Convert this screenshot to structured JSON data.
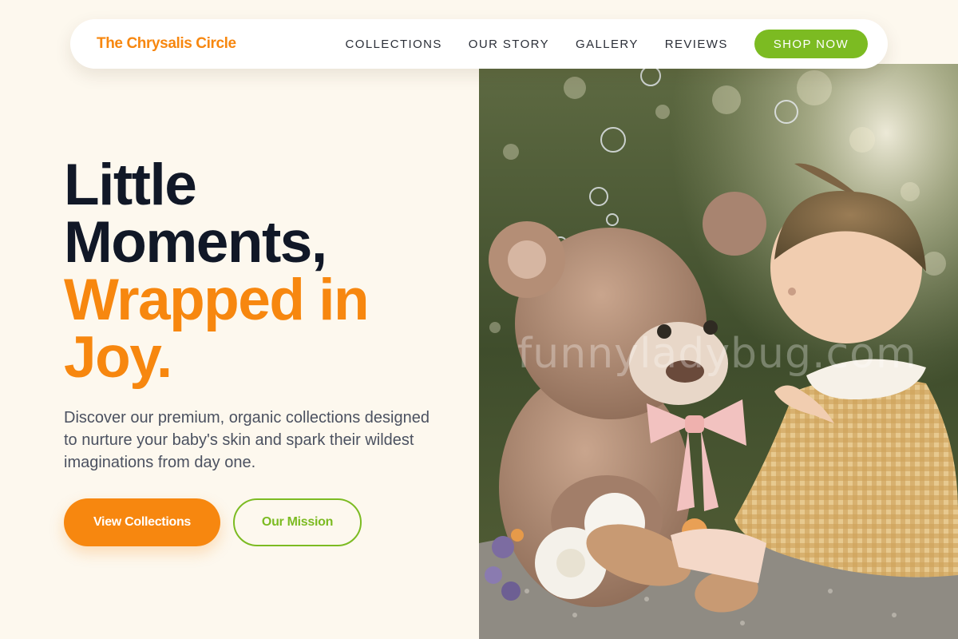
{
  "nav": {
    "brand": "The Chrysalis Circle",
    "links": [
      "COLLECTIONS",
      "OUR STORY",
      "GALLERY",
      "REVIEWS"
    ],
    "cta": "SHOP NOW"
  },
  "hero": {
    "title_dark": [
      "Little",
      "Moments,"
    ],
    "title_accent": [
      "Wrapped in",
      "Joy."
    ],
    "description": "Discover our premium, organic collections designed to nurture your baby's skin and spark their wildest imaginations from day one.",
    "primary_button": "View Collections",
    "secondary_button": "Our Mission",
    "image_alt": "Baby in a gingham dress sitting beside a large teddy bear with bubbles in a sunny park",
    "watermark": "funnyladybug.com"
  },
  "colors": {
    "accent_orange": "#f7870f",
    "accent_green": "#7cbb22",
    "heading": "#111827",
    "background": "#fdf8ee"
  },
  "icons": []
}
